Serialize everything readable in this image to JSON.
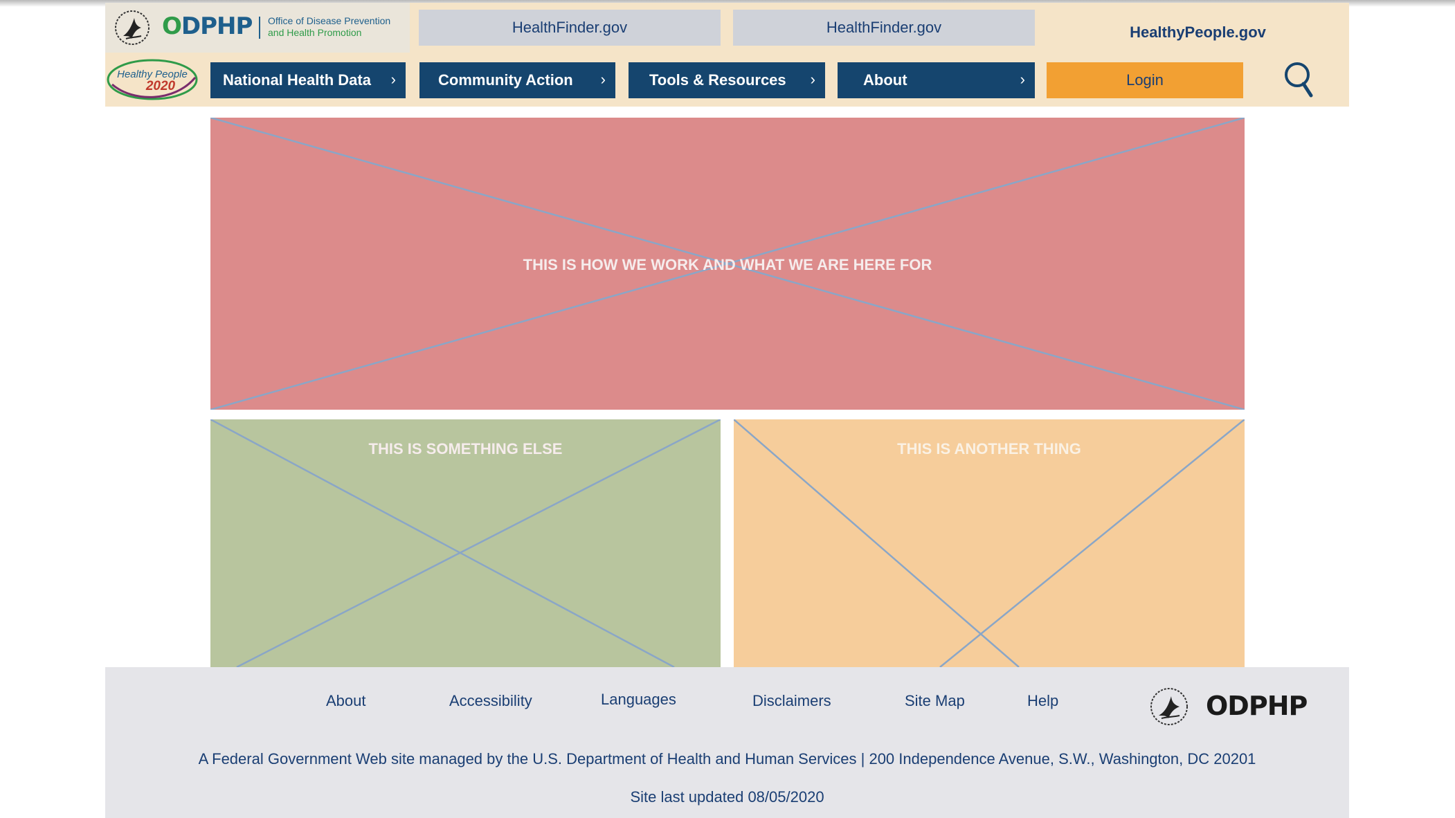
{
  "header": {
    "odphp_logo_text": "ODPHP",
    "odphp_subtitle_line1": "Office of Disease Prevention",
    "odphp_subtitle_line2": "and Health Promotion",
    "site_tabs": [
      {
        "label": "HealthFinder.gov"
      },
      {
        "label": "HealthFinder.gov"
      },
      {
        "label": "HealthyPeople.gov",
        "active": true
      }
    ],
    "healthy_people_logo_line1": "Healthy People",
    "healthy_people_logo_line2": "2020"
  },
  "nav": {
    "items": [
      {
        "label": "National Health Data",
        "icon": "chevron-right-icon"
      },
      {
        "label": "Community Action",
        "icon": "chevron-right-icon"
      },
      {
        "label": "Tools & Resources",
        "icon": "chevron-right-icon"
      },
      {
        "label": "About",
        "icon": "chevron-right-icon"
      }
    ],
    "login_label": "Login",
    "search_icon": "search-icon"
  },
  "main": {
    "hero_text": "THIS IS HOW WE WORK AND WHAT WE ARE HERE FOR",
    "card_left_text": "THIS IS SOMETHING ELSE",
    "card_right_text": "THIS IS ANOTHER THING"
  },
  "footer": {
    "links": [
      "About",
      "Accessibility",
      "Languages",
      "Disclaimers",
      "Site Map",
      "Help"
    ],
    "logo_text": "ODPHP",
    "address": "A Federal Government Web site managed by the U.S. Department of Health and Human Services | 200 Independence Avenue, S.W., Washington, DC 20201",
    "updated": "Site last updated 08/05/2020"
  },
  "colors": {
    "header_bg": "#f5e4c8",
    "nav_bg": "#15456e",
    "login_bg": "#f2a033",
    "hero_bg": "#dc8b8b",
    "card_left_bg": "#b8c59e",
    "card_right_bg": "#f6cd9b",
    "footer_bg": "#e5e5e9",
    "text_link": "#1a3e73"
  }
}
